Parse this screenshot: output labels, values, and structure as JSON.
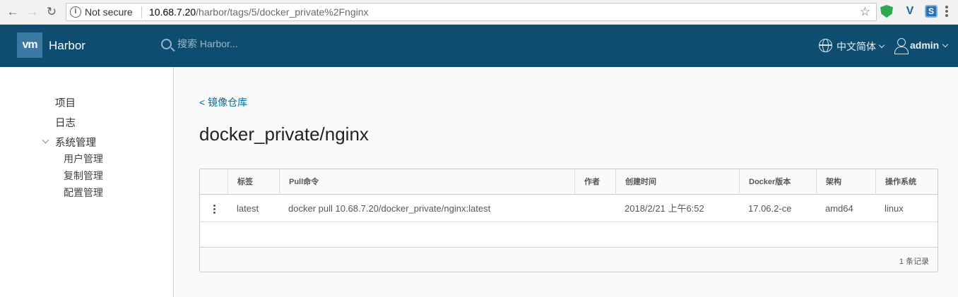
{
  "browser": {
    "security_label": "Not secure",
    "url_host": "10.68.7.20",
    "url_path": "/harbor/tags/5/docker_private%2Fnginx",
    "icons": [
      "back-icon",
      "forward-icon",
      "reload-icon",
      "info-icon",
      "star-icon",
      "shield-extension-icon",
      "v-extension-icon",
      "s-extension-icon",
      "menu-icon"
    ]
  },
  "header": {
    "logo_text": "vm",
    "brand": "Harbor",
    "search_placeholder": "搜索 Harbor...",
    "language": "中文简体",
    "user": "admin",
    "colors": {
      "background": "#0e4d70",
      "logo": "#3b78a2"
    }
  },
  "sidebar": {
    "items": [
      {
        "label": "项目"
      },
      {
        "label": "日志"
      },
      {
        "label": "系统管理",
        "expanded": true,
        "children": [
          {
            "label": "用户管理"
          },
          {
            "label": "复制管理"
          },
          {
            "label": "配置管理"
          }
        ]
      }
    ]
  },
  "main": {
    "breadcrumb": "< 镜像仓库",
    "title": "docker_private/nginx",
    "table": {
      "columns": [
        "标签",
        "Pull命令",
        "作者",
        "创建时间",
        "Docker版本",
        "架构",
        "操作系统"
      ],
      "rows": [
        {
          "tag": "latest",
          "pull": "docker pull 10.68.7.20/docker_private/nginx:latest",
          "author": "",
          "created": "2018/2/21 上午6:52",
          "docker_version": "17.06.2-ce",
          "arch": "amd64",
          "os": "linux"
        }
      ],
      "footer_count": "1 条记录"
    },
    "colors": {
      "link": "#0072a3"
    }
  }
}
